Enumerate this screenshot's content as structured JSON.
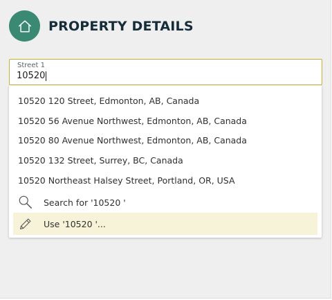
{
  "header": {
    "title": "PROPERTY DETAILS",
    "icon": "home-icon"
  },
  "street_field": {
    "label": "Street 1",
    "value": "10520"
  },
  "suggestions": [
    "10520 120 Street, Edmonton, AB, Canada",
    "10520 56 Avenue Northwest, Edmonton, AB, Canada",
    "10520 80 Avenue Northwest, Edmonton, AB, Canada",
    "10520 132 Street, Surrey, BC, Canada",
    "10520 Northeast Halsey Street, Portland, OR, USA"
  ],
  "actions": {
    "search": {
      "label": "Search for '10520 '",
      "icon": "search-icon"
    },
    "use": {
      "label": "Use '10520 '...",
      "icon": "pencil-icon"
    }
  },
  "colors": {
    "brand_green": "#3a8a73",
    "title_navy": "#142d38",
    "focus_border": "#c7b22b",
    "highlight_row": "#f7f3d8"
  }
}
